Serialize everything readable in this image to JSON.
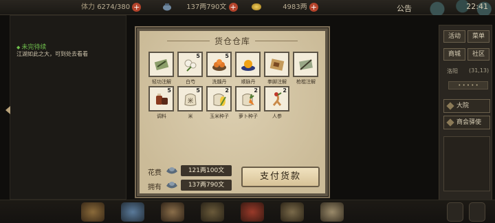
{
  "topbar": {
    "stamina_label": "体力",
    "stamina_value": "6274/380",
    "money_value": "137两790文",
    "gold_value": "4983两",
    "notice": "公告",
    "time": "22:41"
  },
  "quest": {
    "title": "未完待续",
    "desc": "江湖如此之大，可到处去看看"
  },
  "right_panel": {
    "btn_activity": "活动",
    "btn_menu": "菜单",
    "btn_shop": "商城",
    "btn_community": "社区",
    "location": "洛阳",
    "coords": "(31,13)",
    "btn_city": "大院",
    "btn_trade": "商会驿使"
  },
  "dialog": {
    "title": "货仓仓库",
    "items": [
      {
        "name": "轻功注解",
        "count": ""
      },
      {
        "name": "白芍",
        "count": "5"
      },
      {
        "name": "洗髓丹",
        "count": "5"
      },
      {
        "name": "顺脉丹",
        "count": ""
      },
      {
        "name": "拳脚注解",
        "count": ""
      },
      {
        "name": "枪棍注解",
        "count": ""
      },
      {
        "name": "调料",
        "count": "5"
      },
      {
        "name": "米",
        "count": "5"
      },
      {
        "name": "玉米种子",
        "count": "2"
      },
      {
        "name": "萝卜种子",
        "count": "2"
      },
      {
        "name": "人参",
        "count": "2"
      }
    ],
    "cost_label": "花费",
    "cost_value": "121两100文",
    "own_label": "拥有",
    "own_value": "137两790文",
    "pay_button": "支付货款"
  },
  "colors": {
    "dialog_bg": "#d2c3a2",
    "frame": "#5f5545",
    "accent_red": "#b5442c",
    "quest_green": "#6fbf4c"
  }
}
